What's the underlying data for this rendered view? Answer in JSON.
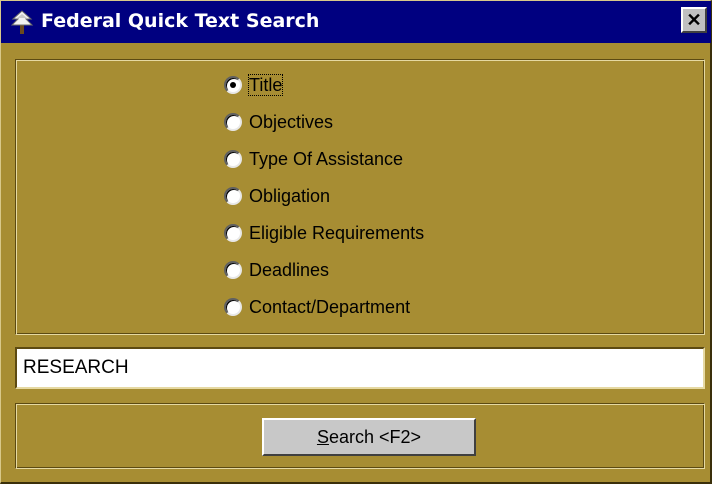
{
  "window": {
    "title": "Federal Quick Text Search",
    "close_glyph": "✕",
    "title_bar_color": "#000080",
    "background_color": "#a78d33"
  },
  "search_fields": {
    "selected": "Title",
    "options": [
      {
        "label": "Title",
        "selected": true
      },
      {
        "label": "Objectives",
        "selected": false
      },
      {
        "label": "Type Of Assistance",
        "selected": false
      },
      {
        "label": "Obligation",
        "selected": false
      },
      {
        "label": "Eligible Requirements",
        "selected": false
      },
      {
        "label": "Deadlines",
        "selected": false
      },
      {
        "label": "Contact/Department",
        "selected": false
      }
    ]
  },
  "search_input": {
    "value": "RESEARCH",
    "placeholder": ""
  },
  "search_button": {
    "accelerator": "S",
    "label_rest": "earch <F2>"
  },
  "icons": {
    "app": "tree-icon",
    "close": "close-icon",
    "radio": "radio-button-icon"
  }
}
